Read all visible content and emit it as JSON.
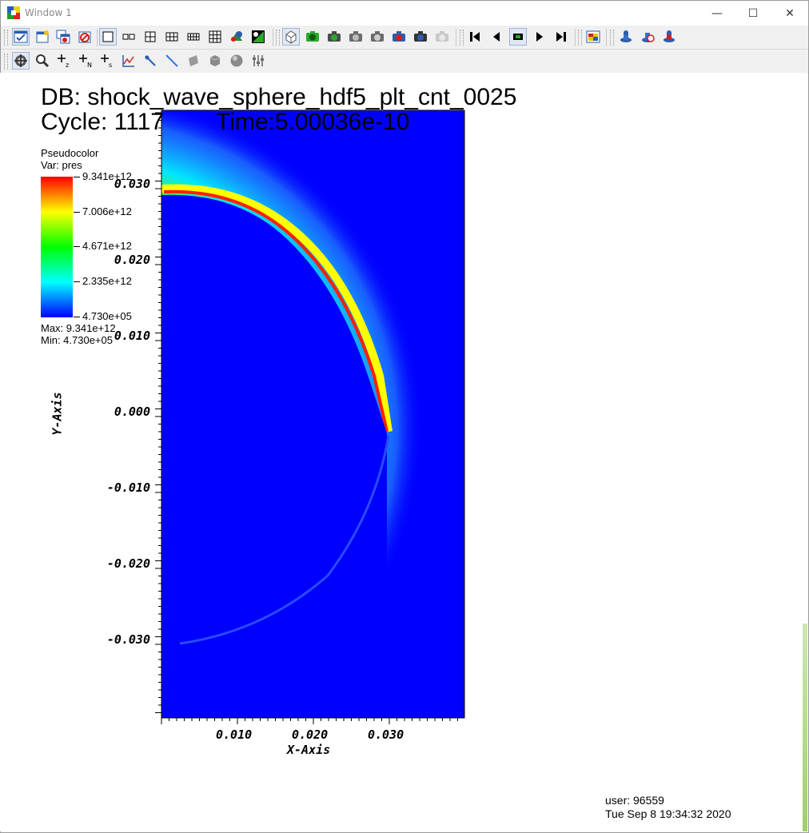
{
  "window": {
    "title": "Window 1",
    "controls": {
      "minimize": "—",
      "maximize": "☐",
      "close": "✕"
    }
  },
  "toolbar1": {
    "icons": [
      "apply-icon",
      "new-window-icon",
      "copy-window-icon",
      "delete-window-icon",
      "layout-1x1-icon",
      "layout-1x2-icon",
      "layout-2x2-icon",
      "layout-2x3-icon",
      "layout-2x4-icon",
      "layout-3x3-icon",
      "lock-view-icon",
      "lock-time-icon",
      "invert-background-icon",
      "spin-mode-icon",
      "save-image-icon",
      "print-icon",
      "camera-icon",
      "camera-2-icon",
      "camera-3-icon",
      "camera-4-icon",
      "camera-5-icon",
      "step-back-icon",
      "reverse-icon",
      "stop-icon",
      "play-icon",
      "step-forward-icon",
      "plot-icon",
      "engine-1-icon",
      "engine-2-icon",
      "engine-3-icon"
    ]
  },
  "toolbar2": {
    "icons": [
      "navigate-icon",
      "zoom-icon",
      "zone-pick-icon",
      "node-pick-icon",
      "spreadsheet-pick-icon",
      "lineout-icon",
      "point-tool-icon",
      "line-tool-icon",
      "plane-tool-icon",
      "box-tool-icon",
      "sphere-tool-icon",
      "axis-array-icon"
    ]
  },
  "plot": {
    "db": "DB: shock_wave_sphere_hdf5_plt_cnt_0025",
    "cycle": "Cycle: 1117",
    "time": "Time:5.00036e-10",
    "xaxis_title": "X-Axis",
    "yaxis_title": "Y-Axis",
    "xticks": [
      "0.010",
      "0.020",
      "0.030"
    ],
    "yticks": [
      "0.030",
      "0.020",
      "0.010",
      "0.000",
      "-0.010",
      "-0.020",
      "-0.030"
    ]
  },
  "legend": {
    "title": "Pseudocolor",
    "var": "Var: pres",
    "ticks": [
      "9.341e+12",
      "7.006e+12",
      "4.671e+12",
      "2.335e+12",
      "4.730e+05"
    ],
    "max": "Max:  9.341e+12",
    "min": "Min:  4.730e+05"
  },
  "footer": {
    "user": "user: 96559",
    "date": "Tue Sep  8 19:34:32 2020"
  },
  "colors": {
    "background_field": "#0000ff",
    "shock_front": "#ff0000",
    "halo": "#00ffff"
  }
}
